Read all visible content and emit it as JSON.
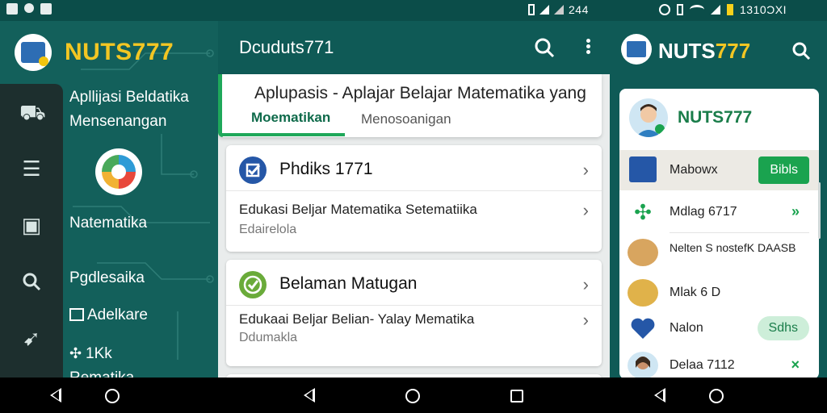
{
  "status_bar": {
    "mid_clock": "244",
    "right_clock": "1310ƆXI"
  },
  "panel_left": {
    "brand": "NUTS777",
    "title": "Apllijasi Beldatika Mensenangan",
    "items": [
      {
        "label": "Natematika",
        "icon": "math-logo-icon"
      },
      {
        "label": "Pgdlesaika",
        "icon": ""
      },
      {
        "label": "Adelkare",
        "icon": "image-icon"
      },
      {
        "label": "1Kk",
        "icon": "puzzle-icon"
      },
      {
        "label": "Rematika",
        "icon": ""
      }
    ],
    "rail_icons": [
      "basket-icon",
      "list-icon",
      "briefcase-icon",
      "search-icon",
      "rocket-icon"
    ]
  },
  "panel_mid": {
    "title": "Dcuduts771",
    "banner": {
      "text": "Aplupasis - Aplajar Belajar Matematika yang",
      "tab_active": "Moematikan",
      "tab_other": "Menosoanigan"
    },
    "cards": [
      {
        "icon_color": "#2557a7",
        "icon": "checkbox-icon",
        "title": "Phdiks 1771",
        "line1": "Edukasi Beljar Matematika Setematiika",
        "line2": "Edairelola"
      },
      {
        "icon_color": "#6aab3a",
        "icon": "check-icon",
        "title": "Belaman Matugan",
        "line1": "Edukaai Beljar Belian- Yalay Mematika",
        "line2": "Ddumakla"
      }
    ]
  },
  "panel_right": {
    "brand_a": "NUTS",
    "brand_b": "777",
    "profile_name": "NUTS777",
    "rows": [
      {
        "label": "Mabowx",
        "action": "Bibls",
        "action_style": "button",
        "icon": "chart-icon",
        "highlighted": true
      },
      {
        "label": "Mdlag 6717",
        "action": "»",
        "action_style": "mark",
        "icon": "puzzle-icon",
        "highlighted": false
      },
      {
        "label": "Nelten S nostefK DAASB",
        "action": "",
        "action_style": "none",
        "icon": "box-icon",
        "highlighted": false
      },
      {
        "label": "Mlak 6 D",
        "action": "",
        "action_style": "none",
        "icon": "food-icon",
        "highlighted": false
      },
      {
        "label": "Nalon",
        "action": "Sdhs",
        "action_style": "pill",
        "icon": "heart-icon",
        "highlighted": false
      },
      {
        "label": "Delaa 7112",
        "action": "×",
        "action_style": "mark",
        "icon": "avatar-icon",
        "highlighted": false
      }
    ]
  }
}
